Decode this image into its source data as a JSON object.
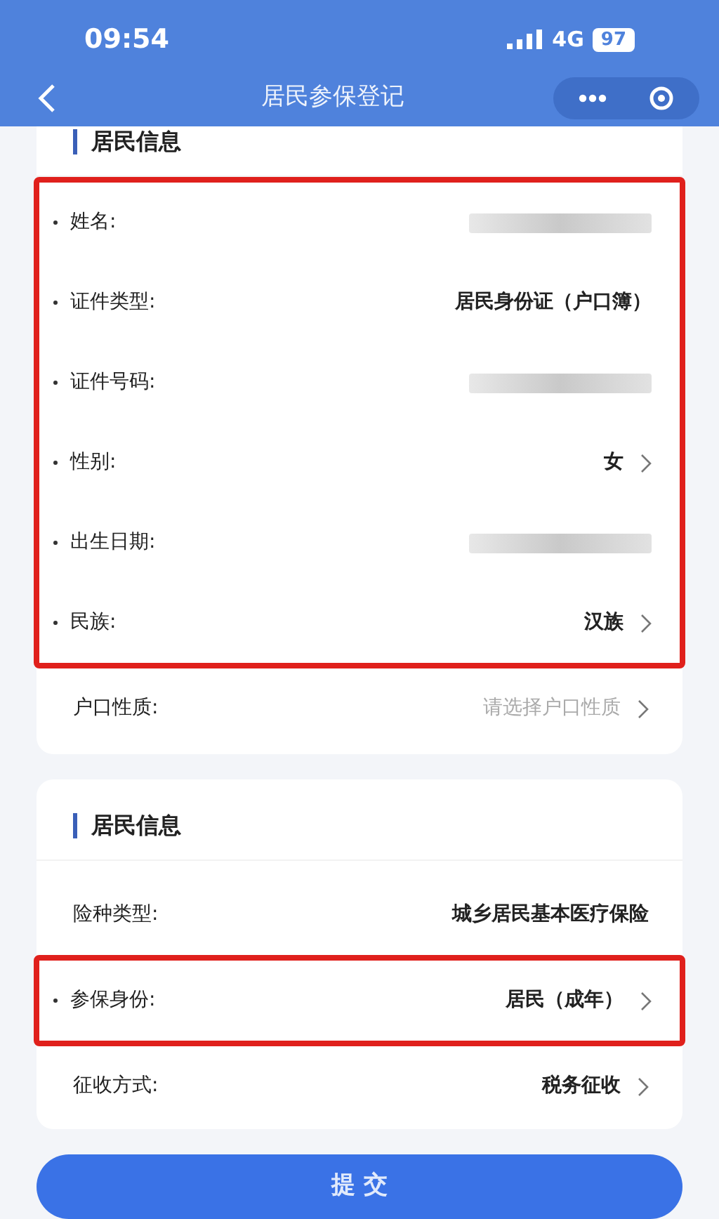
{
  "status_bar": {
    "time": "09:54",
    "network": "4G",
    "battery": "97"
  },
  "nav": {
    "title": "居民参保登记"
  },
  "cards": [
    {
      "title": "居民信息",
      "rows": [
        {
          "label": "姓名:",
          "kind": "redacted",
          "required": true,
          "arrow": false,
          "highlighted": true
        },
        {
          "label": "证件类型:",
          "kind": "text",
          "value": "居民身份证（户口簿）",
          "required": true,
          "arrow": false,
          "highlighted": true
        },
        {
          "label": "证件号码:",
          "kind": "redacted",
          "required": true,
          "arrow": false,
          "highlighted": true
        },
        {
          "label": "性别:",
          "kind": "text",
          "value": "女",
          "required": true,
          "arrow": true,
          "highlighted": true
        },
        {
          "label": "出生日期:",
          "kind": "redacted",
          "required": true,
          "arrow": false,
          "highlighted": true
        },
        {
          "label": "民族:",
          "kind": "text",
          "value": "汉族",
          "required": true,
          "arrow": true,
          "highlighted": true
        },
        {
          "label": "户口性质:",
          "kind": "placeholder",
          "placeholder": "请选择户口性质",
          "required": false,
          "arrow": true,
          "highlighted": false
        }
      ]
    },
    {
      "title": "居民信息",
      "rows": [
        {
          "label": "险种类型:",
          "kind": "text",
          "value": "城乡居民基本医疗保险",
          "required": false,
          "arrow": false,
          "highlighted": false
        },
        {
          "label": "参保身份:",
          "kind": "text",
          "value": "居民（成年）",
          "required": true,
          "arrow": true,
          "highlighted": true
        },
        {
          "label": "征收方式:",
          "kind": "text",
          "value": "税务征收",
          "required": false,
          "arrow": true,
          "highlighted": false
        }
      ]
    }
  ],
  "submit": {
    "label": "提 交"
  }
}
